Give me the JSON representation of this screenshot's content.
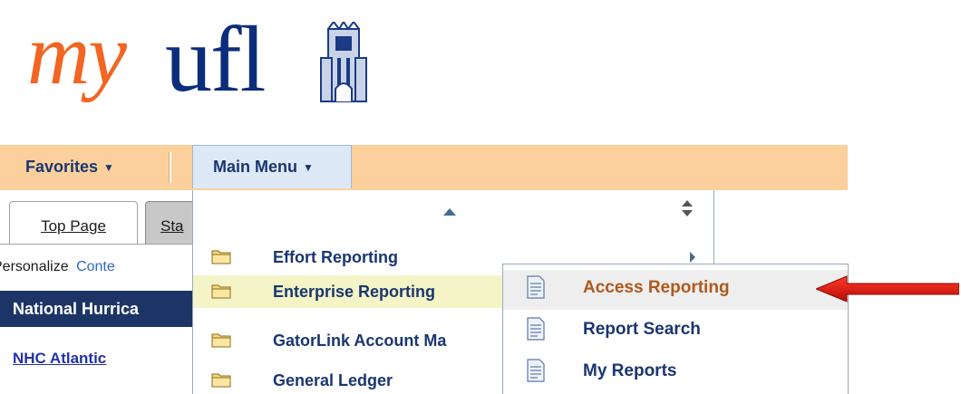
{
  "logo": {
    "my": "my",
    "ufl": "ufl",
    "icon": "tower-icon",
    "colors": {
      "my": "#f26522",
      "ufl": "#0b2d7c"
    }
  },
  "menubar": {
    "favorites_label": "Favorites",
    "main_menu_label": "Main Menu",
    "background": "#fcd09c"
  },
  "tabs": [
    {
      "label": "Top Page"
    },
    {
      "label": "Sta"
    }
  ],
  "personalize": {
    "label": "Personalize",
    "link": "Conte"
  },
  "pagelet": {
    "title": "National Hurrica",
    "link": "NHC Atlantic"
  },
  "main_menu": {
    "items": [
      {
        "label": "Effort Reporting",
        "icon": "folder-icon",
        "has_submenu": true
      },
      {
        "label": "Enterprise Reporting",
        "icon": "folder-icon",
        "highlighted": true
      },
      {
        "label": "GatorLink Account Ma",
        "icon": "folder-icon"
      },
      {
        "label": "General Ledger",
        "icon": "folder-icon"
      }
    ]
  },
  "submenu": {
    "items": [
      {
        "label": "Access Reporting",
        "icon": "document-icon",
        "highlighted": true
      },
      {
        "label": "Report Search",
        "icon": "document-icon"
      },
      {
        "label": "My Reports",
        "icon": "document-icon"
      }
    ]
  },
  "annotation": {
    "icon": "red-arrow-icon",
    "color": "#e8140c"
  }
}
